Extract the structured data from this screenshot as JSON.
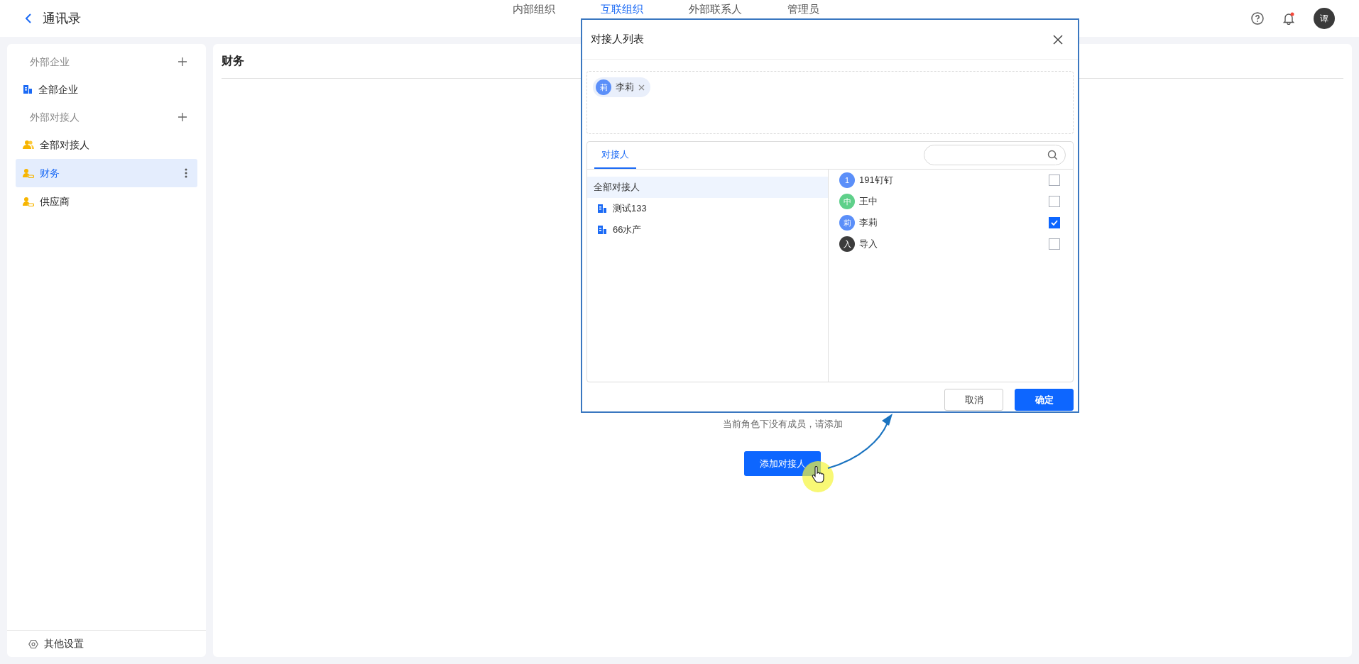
{
  "header": {
    "title": "通讯录",
    "avatar": "谭",
    "nav": [
      {
        "label": "内部组织",
        "selected": false
      },
      {
        "label": "互联组织",
        "selected": true
      },
      {
        "label": "外部联系人",
        "selected": false
      },
      {
        "label": "管理员",
        "selected": false
      }
    ]
  },
  "sidebar": {
    "sections": [
      {
        "title": "外部企业",
        "items": [
          {
            "label": "全部企业",
            "kind": "company",
            "selected": false
          }
        ]
      },
      {
        "title": "外部对接人",
        "items": [
          {
            "label": "全部对接人",
            "kind": "group",
            "selected": false
          },
          {
            "label": "财务",
            "kind": "role",
            "selected": true
          },
          {
            "label": "供应商",
            "kind": "role",
            "selected": false
          }
        ]
      }
    ],
    "footer": "其他设置"
  },
  "main": {
    "title": "财务",
    "empty_text": "当前角色下没有成员，请添加",
    "add_button": "添加对接人"
  },
  "dialog": {
    "title": "对接人列表",
    "chosen": [
      {
        "avatar": "莉",
        "name": "李莉",
        "color": "#5b8ff9"
      }
    ],
    "tabs": [
      {
        "label": "对接人",
        "selected": true
      }
    ],
    "tree": [
      {
        "label": "全部对接人",
        "kind": "all",
        "selected": true
      },
      {
        "label": "测试133",
        "kind": "company",
        "selected": false
      },
      {
        "label": "66水产",
        "kind": "company",
        "selected": false
      }
    ],
    "members": [
      {
        "avatar": "1",
        "name": "191钉钉",
        "color": "#5b8ff9",
        "checked": false
      },
      {
        "avatar": "中",
        "name": "王中",
        "color": "#5fd08a",
        "checked": false
      },
      {
        "avatar": "莉",
        "name": "李莉",
        "color": "#5b8ff9",
        "checked": true
      },
      {
        "avatar": "入",
        "name": "导入",
        "color": "#3c3c3c",
        "checked": false
      }
    ],
    "buttons": [
      {
        "label": "取消",
        "kind": "secondary"
      },
      {
        "label": "确定",
        "kind": "primary"
      }
    ]
  }
}
